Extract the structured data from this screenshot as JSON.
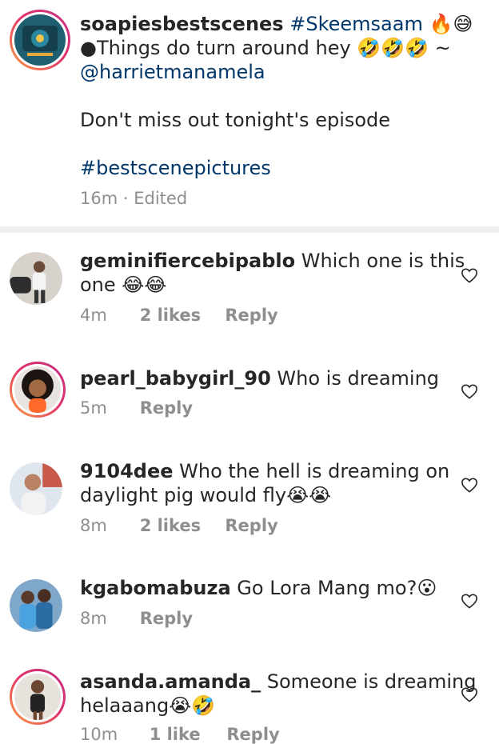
{
  "caption": {
    "username": "soapiesbestscenes",
    "hashtag": "#Skeemsaam",
    "title_suffix": "🔥😅",
    "line2": "●Things do turn around hey",
    "line2_emojis": "🤣🤣🤣",
    "line2_tilde": "~",
    "mention": "@harrietmanamela",
    "line3": "Don't miss out tonight's episode",
    "tag": "#bestscenepictures",
    "time": "16m",
    "edited": "· Edited"
  },
  "comments": [
    {
      "username": "geminifiercebipablo",
      "text_line1": "Which one is this",
      "text_line2": "one 😂😂",
      "time": "4m",
      "likes": "2 likes",
      "reply": "Reply"
    },
    {
      "username": "pearl_babygirl_90",
      "text_line1": "Who is dreaming",
      "time": "5m",
      "reply": "Reply"
    },
    {
      "username": "9104dee",
      "text_line1": "Who the hell is dreaming on",
      "text_line2": "daylight  pig would fly😭😭",
      "time": "8m",
      "likes": "2 likes",
      "reply": "Reply"
    },
    {
      "username": "kgabomabuza",
      "text_line1": "Go Lora Mang mo?😮",
      "time": "8m",
      "reply": "Reply"
    },
    {
      "username": "asanda.amanda_",
      "text_line1": "Someone is dreaming",
      "text_line2": "helaaang😭🤣",
      "time": "10m",
      "likes": "1 like",
      "reply": "Reply"
    }
  ],
  "colors": {
    "text": "#262626",
    "muted": "#8e8e8e",
    "link": "#00376b",
    "divider": "#efefef"
  },
  "icons": {
    "like": "heart-outline-icon"
  }
}
